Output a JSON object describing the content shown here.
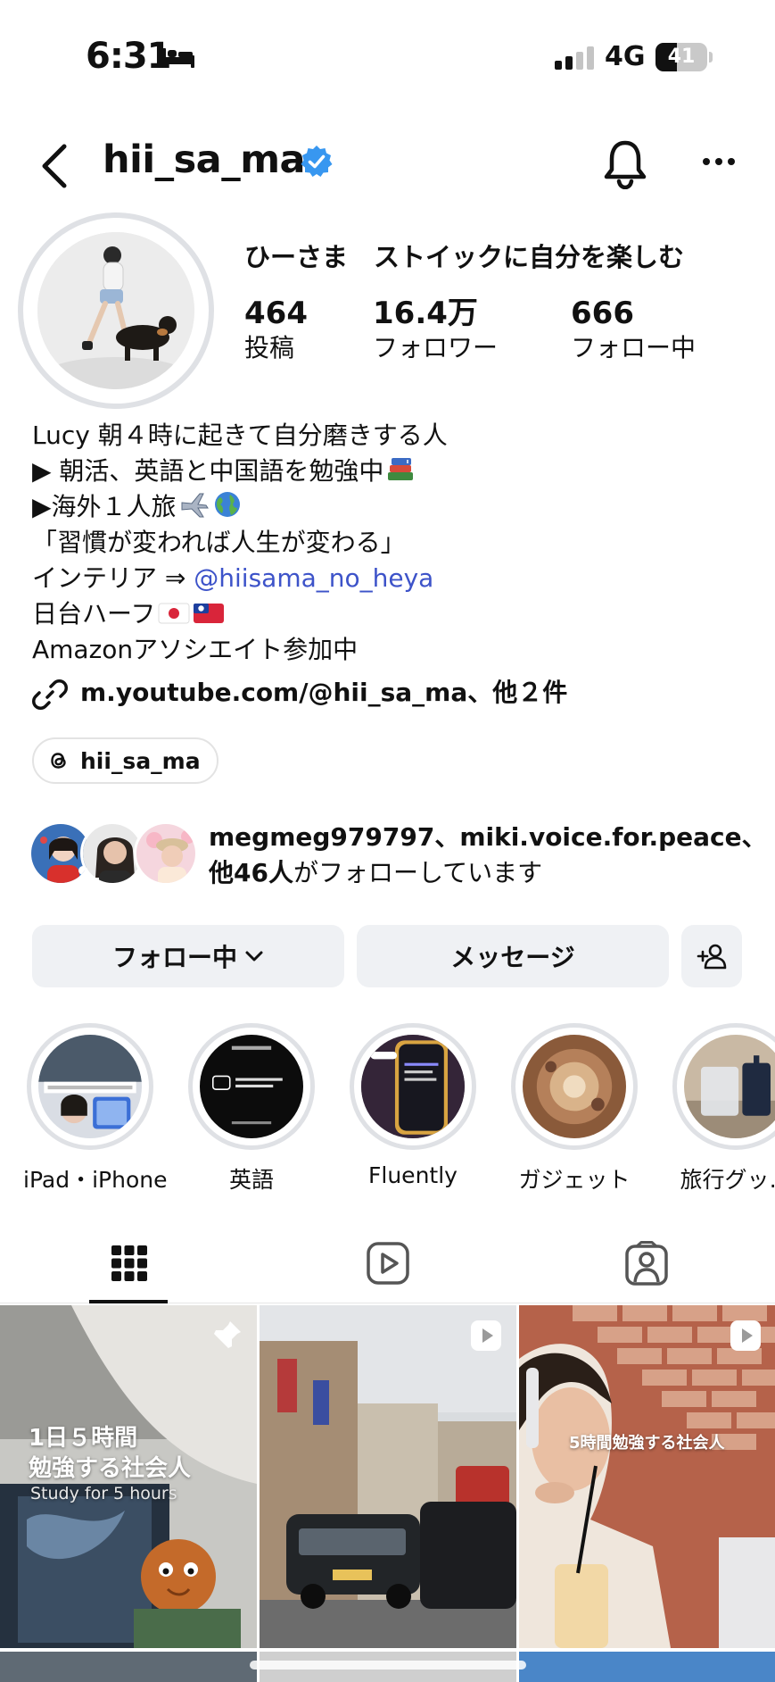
{
  "status_bar": {
    "time": "6:31",
    "network": "4G",
    "battery": "41",
    "battery_level": 0.41
  },
  "header": {
    "username": "hii_sa_ma"
  },
  "profile": {
    "display_name": "ひーさま　ストイックに自分を楽しむ",
    "stats": [
      {
        "value": "464",
        "label": "投稿"
      },
      {
        "value": "16.4万",
        "label": "フォロワー"
      },
      {
        "value": "666",
        "label": "フォロー中"
      }
    ],
    "bio": {
      "line1": "Lucy  朝４時に起きて自分磨きする人",
      "line2": "▶︎ 朝活、英語と中国語を勉強中",
      "line3": "▶︎海外１人旅",
      "line4": "「習慣が変われば人生が変わる」",
      "line5_prefix": "インテリア ⇒ ",
      "line5_mention": "@hiisama_no_heya",
      "line6": "日台ハーフ",
      "line7": "Amazonアソシエイト参加中"
    },
    "link": "m.youtube.com/@hii_sa_ma、他２件",
    "threads": "hii_sa_ma",
    "mutual": {
      "names": "megmeg979797、miki.voice.for.peace、",
      "count": "他46人",
      "suffix": "がフォローしています"
    }
  },
  "buttons": {
    "following": "フォロー中",
    "message": "メッセージ"
  },
  "highlights": [
    {
      "label": "iPad・iPhone"
    },
    {
      "label": "英語"
    },
    {
      "label": "Fluently"
    },
    {
      "label": "ガジェット"
    },
    {
      "label": "旅行グッ…"
    }
  ],
  "grid": {
    "post1": {
      "title1": "1日５時間",
      "title2": "勉強する社会人",
      "subtitle": "Study for 5 hours"
    },
    "post3": {
      "caption": "5時間勉強する社会人"
    }
  },
  "colors": {
    "accent": "#3d53c9",
    "verified": "#3897f0",
    "button_bg": "#eff1f4"
  }
}
